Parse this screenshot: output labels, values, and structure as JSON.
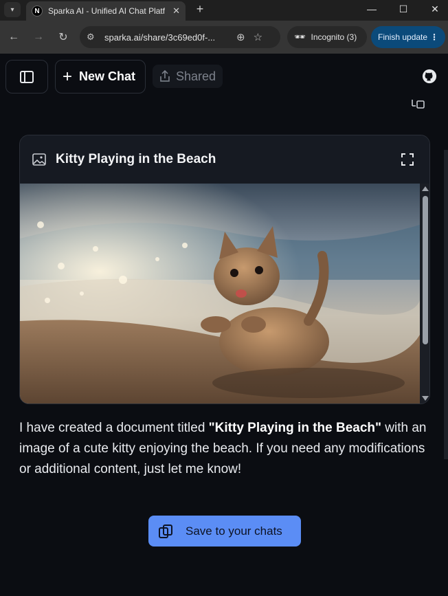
{
  "browser": {
    "tab_title": "Sparka AI - Unified AI Chat Platform",
    "tab_favicon": "N",
    "url": "sparka.ai/share/3c69ed0f-...",
    "incognito_label": "Incognito (3)",
    "finish_update_label": "Finish update"
  },
  "header": {
    "new_chat_label": "New Chat",
    "shared_label": "Shared"
  },
  "document": {
    "title": "Kitty Playing in the Beach"
  },
  "message": {
    "prefix": "I have created a document titled ",
    "title_bold": "\"Kitty Playing in the Beach\"",
    "suffix": " with an image of a cute kitty enjoying the beach. If you need any modifications or additional content, just let me know!"
  },
  "actions": {
    "save_label": "Save to your chats"
  },
  "colors": {
    "accent": "#5b8df5",
    "background": "#0b0d12"
  }
}
